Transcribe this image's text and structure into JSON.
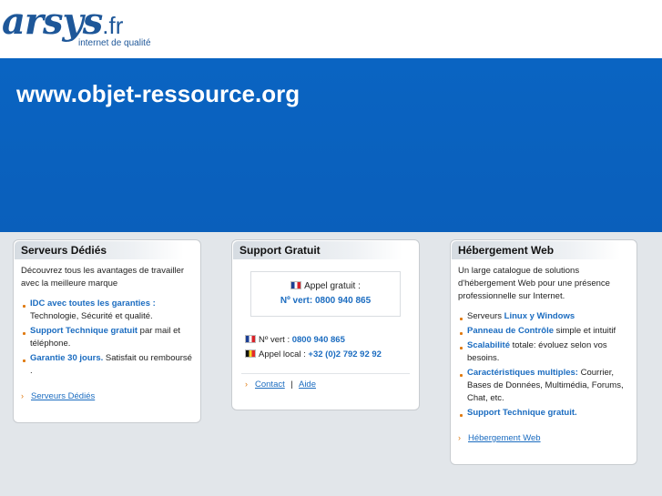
{
  "logo": {
    "brand": "arsys",
    "tld": ".fr",
    "tagline": "internet de qualité"
  },
  "banner": {
    "title": "www.objet-ressource.org"
  },
  "colors": {
    "accent": "#0a64c2",
    "link": "#1b6cc0",
    "bullet": "#e07a10"
  },
  "panels": {
    "dedies": {
      "title": "Serveurs Dédiés",
      "intro": "Découvrez tous les avantages de travailler avec la meilleure marque",
      "items": [
        {
          "strong": "IDC avec toutes les garanties :",
          "rest": " Technologie, Sécurité et qualité."
        },
        {
          "strong": "Support Technique gratuit",
          "rest": " par mail et téléphone."
        },
        {
          "strong": "Garantie 30 jours.",
          "rest": " Satisfait ou remboursé ."
        }
      ],
      "link": "Serveurs Dédiés"
    },
    "support": {
      "title": "Support Gratuit",
      "call_label": "Appel gratuit :",
      "call_number": "Nº vert: 0800 940 865",
      "vert_label": "Nº vert :",
      "vert_number": "0800 940 865",
      "local_label": "Appel local :",
      "local_number": "+32 (0)2 792 92 92",
      "contact": "Contact",
      "sep": "|",
      "aide": "Aide",
      "flags": [
        "france-flag",
        "belgium-flag"
      ]
    },
    "hebergement": {
      "title": "Hébergement Web",
      "intro": "Un large catalogue de solutions d'hébergement Web pour une présence professionnelle sur Internet.",
      "items": [
        {
          "pre": "Serveurs ",
          "strong": "Linux y Windows",
          "rest": ""
        },
        {
          "pre": "",
          "strong": "Panneau de Contrôle",
          "rest": " simple et intuitif"
        },
        {
          "pre": "",
          "strong": "Scalabilité",
          "rest": " totale: évoluez selon vos besoins."
        },
        {
          "pre": "",
          "strong": "Caractéristiques multiples:",
          "rest": " Courrier, Bases de Données, Multimédia, Forums, Chat, etc."
        },
        {
          "pre": "",
          "strong": "Support Technique gratuit.",
          "rest": ""
        }
      ],
      "link": "Hébergement Web"
    }
  }
}
